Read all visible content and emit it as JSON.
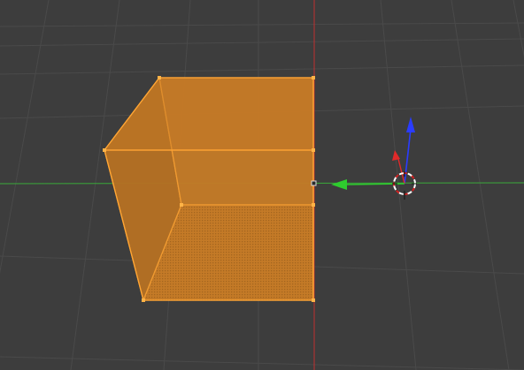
{
  "viewport": {
    "background": "#3d3d3d",
    "grid_color": "#4a4a4a",
    "x_axis_color": "#3aaa3a",
    "z_axis_color": "#c03030"
  },
  "selection": {
    "object": "cube",
    "selected_face": "bottom",
    "face_fill": "#c47a27",
    "edge_color": "#ffa534",
    "vertex_color": "#ffb347"
  },
  "gizmo": {
    "x_arrow_color": "#2ecc2e",
    "y_arrow_color": "#e02a2a",
    "z_arrow_color": "#2a3cff",
    "pivot_icon": "3d-cursor-icon"
  }
}
